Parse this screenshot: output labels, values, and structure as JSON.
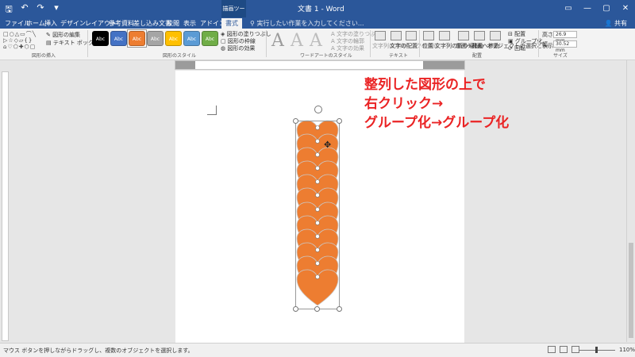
{
  "titlebar": {
    "qat_icons": [
      "save-icon",
      "undo-icon",
      "redo-icon",
      "customize-icon"
    ],
    "qat_glyphs": [
      "🖫",
      "↶",
      "↷",
      "▾"
    ],
    "context_tool": "描画ツール",
    "doc_title": "文書 1 - Word",
    "window_controls": [
      "▭",
      "—",
      "▢",
      "✕"
    ]
  },
  "tabs": [
    "ファイル",
    "ホーム",
    "挿入",
    "デザイン",
    "レイアウト",
    "参考資料",
    "差し込み文書",
    "校閲",
    "表示",
    "アドイン",
    "書式"
  ],
  "active_tab": "書式",
  "tellme": "実行したい作業を入力してください...",
  "share": "共有",
  "ribbon": {
    "insert_shapes": {
      "edit_shape": "図形の編集",
      "textbox": "テキスト ボックス",
      "label": "図形の挿入"
    },
    "shape_styles": {
      "buttons": [
        {
          "text": "Abc",
          "color": "#000000"
        },
        {
          "text": "Abc",
          "color": "#4472c4"
        },
        {
          "text": "Abc",
          "color": "#ed7d31"
        },
        {
          "text": "Abc",
          "color": "#a5a5a5"
        },
        {
          "text": "Abc",
          "color": "#ffc000"
        },
        {
          "text": "Abc",
          "color": "#5b9bd5"
        },
        {
          "text": "Abc",
          "color": "#70ad47"
        }
      ],
      "fill": "図形の塗りつぶし",
      "outline": "図形の枠線",
      "effects": "図形の効果",
      "label": "図形のスタイル"
    },
    "wordart": {
      "letters": [
        "A",
        "A",
        "A"
      ],
      "fill": "文字の塗りつぶし",
      "outline": "文字の輪郭",
      "effects": "文字の効果",
      "label": "ワードアートのスタイル"
    },
    "text": {
      "direction": "文字列の方向",
      "align": "文字の配置",
      "link": "リンクの作成",
      "label": "テキスト"
    },
    "arrange": {
      "position": "位置",
      "wrap": "文字列の折り返し",
      "forward": "前面へ移動",
      "backward": "背面へ移動",
      "selection_pane": "オブジェクトの選択と表示",
      "align": "配置",
      "group": "グループ化",
      "rotate": "回転",
      "label": "配置"
    },
    "size": {
      "height_label": "高さ:",
      "height": "26.9 mm",
      "width_label": "幅:",
      "width": "30.52 mm",
      "label": "サイズ"
    }
  },
  "callout": {
    "line1": "整列した図形の上で",
    "line2": "右クリック→",
    "line3": "グループ化→グループ化",
    "color": "#ea2324"
  },
  "shape_color": "#ed7d31",
  "shape_count": 12,
  "statusbar": {
    "message": "マウス ボタンを押しながらドラッグし、複数のオブジェクトを選択します。",
    "zoom": "110%"
  }
}
